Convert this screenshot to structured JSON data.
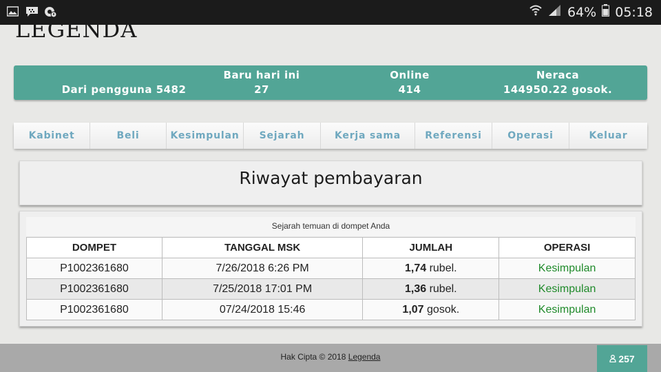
{
  "status_bar": {
    "battery": "64%",
    "time": "05:18",
    "icons": [
      "gallery-icon",
      "bbm-icon",
      "chrome-icon",
      "wifi-icon",
      "signal-icon",
      "battery-icon"
    ]
  },
  "logo": {
    "text": "LEGENDA"
  },
  "stats": {
    "users_label": "Dari pengguna",
    "users_value": "5482",
    "today_label": "Baru hari ini",
    "today_value": "27",
    "online_label": "Online",
    "online_value": "414",
    "balance_label": "Neraca",
    "balance_value": "144950.22 gosok."
  },
  "nav": {
    "items": [
      {
        "label": "Kabinet"
      },
      {
        "label": "Beli"
      },
      {
        "label": "Kesimpulan"
      },
      {
        "label": "Sejarah"
      },
      {
        "label": "Kerja sama"
      },
      {
        "label": "Referensi"
      },
      {
        "label": "Operasi"
      },
      {
        "label": "Keluar"
      }
    ]
  },
  "page_title": "Riwayat pembayaran",
  "history": {
    "caption": "Sejarah temuan di dompet Anda",
    "headers": [
      "DOMPET",
      "TANGGAL MSK",
      "JUMLAH",
      "OPERASI"
    ],
    "rows": [
      {
        "wallet": "P1002361680",
        "date": "7/26/2018 6:26 PM",
        "amount": "1,74",
        "unit": "rubel.",
        "operation": "Kesimpulan"
      },
      {
        "wallet": "P1002361680",
        "date": "7/25/2018 17:01 PM",
        "amount": "1,36",
        "unit": "rubel.",
        "operation": "Kesimpulan"
      },
      {
        "wallet": "P1002361680",
        "date": "07/24/2018 15:46",
        "amount": "1,07",
        "unit": "gosok.",
        "operation": "Kesimpulan"
      }
    ]
  },
  "footer": {
    "copyright": "Hak Cipta © 2018",
    "link": "Legenda",
    "online_count": "257"
  },
  "colors": {
    "accent": "#52a596",
    "nav_text": "#6fa8bf",
    "operation_text": "#1f8a2a",
    "footer_bg": "#a9a9a9"
  }
}
